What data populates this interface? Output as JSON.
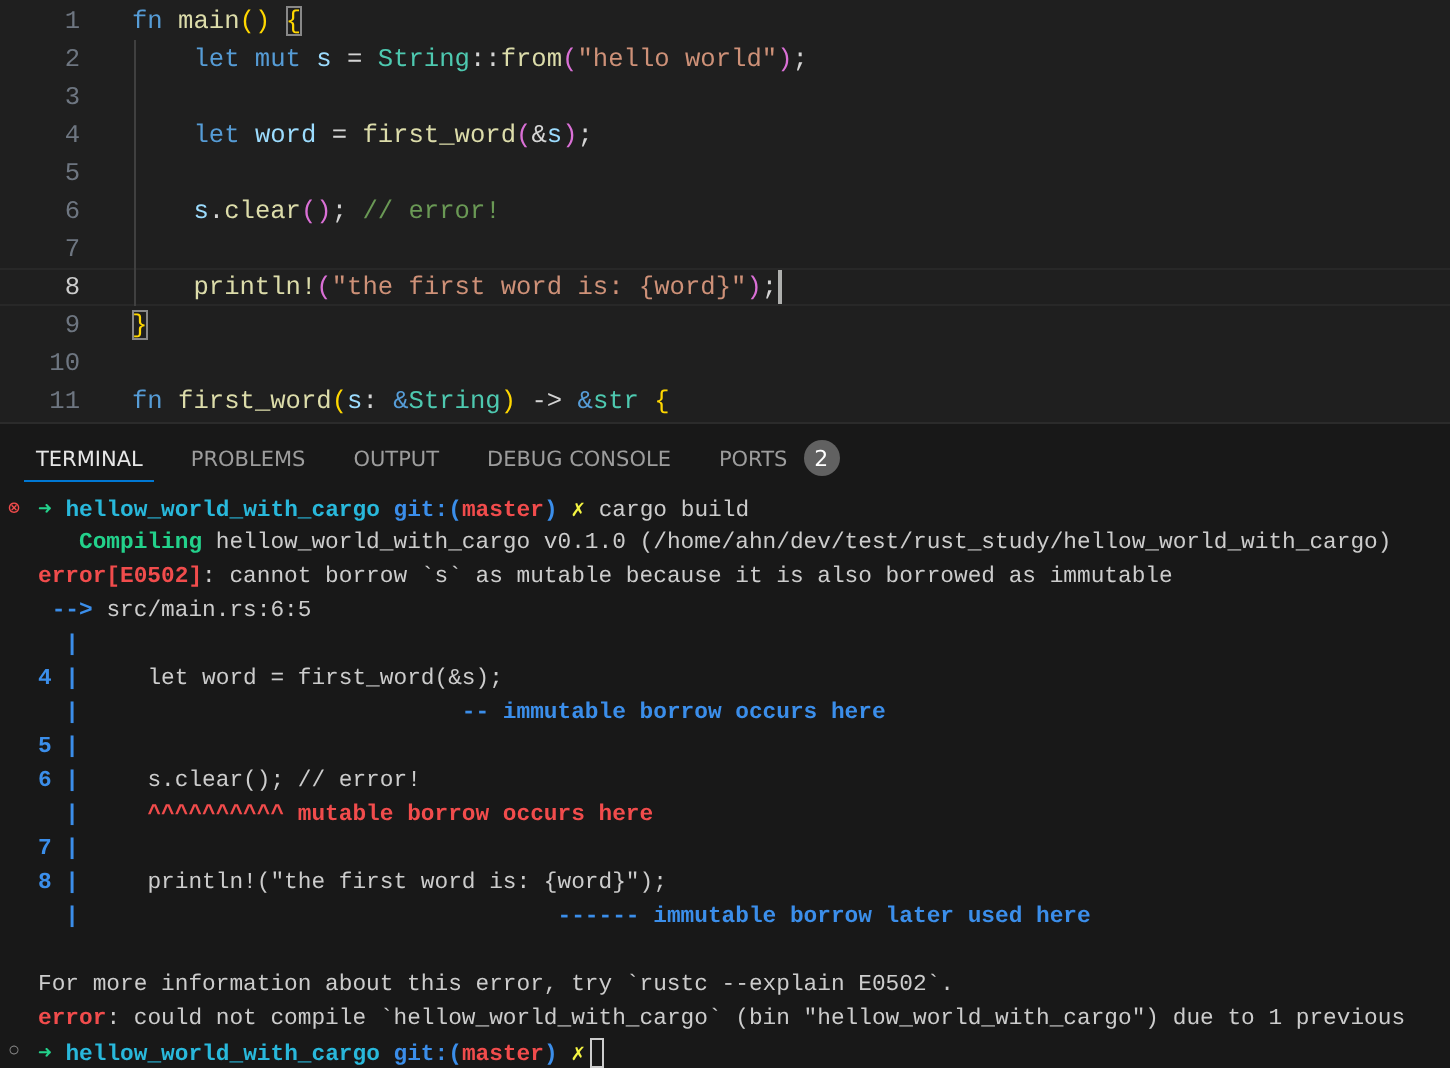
{
  "editor": {
    "lines": [
      {
        "number": "1",
        "current": false,
        "tokens": [
          {
            "text": "fn ",
            "kind": "keyword"
          },
          {
            "text": "main",
            "kind": "function"
          },
          {
            "text": "() ",
            "kind": "bracket1"
          },
          {
            "text": "{",
            "kind": "bracket-match"
          }
        ]
      },
      {
        "number": "2",
        "current": false,
        "tokens": [
          {
            "text": "    let mut ",
            "kind": "keyword"
          },
          {
            "text": "s",
            "kind": "variable"
          },
          {
            "text": " = ",
            "kind": "plain"
          },
          {
            "text": "String",
            "kind": "type"
          },
          {
            "text": "::",
            "kind": "plain"
          },
          {
            "text": "from",
            "kind": "function"
          },
          {
            "text": "(",
            "kind": "bracket2"
          },
          {
            "text": "\"hello world\"",
            "kind": "string"
          },
          {
            "text": ")",
            "kind": "bracket2"
          },
          {
            "text": ";",
            "kind": "plain"
          }
        ]
      },
      {
        "number": "3",
        "current": false
      },
      {
        "number": "4",
        "current": false,
        "tokens": [
          {
            "text": "    let ",
            "kind": "keyword"
          },
          {
            "text": "word",
            "kind": "variable"
          },
          {
            "text": " = ",
            "kind": "plain"
          },
          {
            "text": "first_word",
            "kind": "function"
          },
          {
            "text": "(",
            "kind": "bracket2"
          },
          {
            "text": "&",
            "kind": "plain"
          },
          {
            "text": "s",
            "kind": "variable"
          },
          {
            "text": ")",
            "kind": "bracket2"
          },
          {
            "text": ";",
            "kind": "plain"
          }
        ]
      },
      {
        "number": "5",
        "current": false
      },
      {
        "number": "6",
        "current": false,
        "tokens": [
          {
            "text": "    s",
            "kind": "variable"
          },
          {
            "text": ".",
            "kind": "plain"
          },
          {
            "text": "clear",
            "kind": "function"
          },
          {
            "text": "()",
            "kind": "bracket2"
          },
          {
            "text": "; ",
            "kind": "plain"
          },
          {
            "text": "// error!",
            "kind": "comment"
          }
        ]
      },
      {
        "number": "7",
        "current": false
      },
      {
        "number": "8",
        "current": true,
        "cursor": true,
        "tokens": [
          {
            "text": "    println!",
            "kind": "function"
          },
          {
            "text": "(",
            "kind": "bracket2"
          },
          {
            "text": "\"the first word is: {word}\"",
            "kind": "string"
          },
          {
            "text": ")",
            "kind": "bracket2"
          },
          {
            "text": ";",
            "kind": "plain"
          }
        ]
      },
      {
        "number": "9",
        "current": false,
        "tokens": [
          {
            "text": "}",
            "kind": "bracket-match"
          }
        ]
      },
      {
        "number": "10",
        "current": false
      },
      {
        "number": "11",
        "current": false,
        "tokens": [
          {
            "text": "fn ",
            "kind": "keyword"
          },
          {
            "text": "first_word",
            "kind": "function"
          },
          {
            "text": "(",
            "kind": "bracket1"
          },
          {
            "text": "s",
            "kind": "variable"
          },
          {
            "text": ": ",
            "kind": "plain"
          },
          {
            "text": "&",
            "kind": "keyword"
          },
          {
            "text": "String",
            "kind": "type"
          },
          {
            "text": ")",
            "kind": "bracket1"
          },
          {
            "text": " -> ",
            "kind": "plain"
          },
          {
            "text": "&",
            "kind": "keyword"
          },
          {
            "text": "str ",
            "kind": "type"
          },
          {
            "text": "{",
            "kind": "bracket1"
          }
        ]
      }
    ]
  },
  "panel": {
    "tabs": [
      {
        "label": "TERMINAL",
        "selected": true
      },
      {
        "label": "PROBLEMS",
        "selected": false
      },
      {
        "label": "OUTPUT",
        "selected": false
      },
      {
        "label": "DEBUG CONSOLE",
        "selected": false
      },
      {
        "label": "PORTS",
        "selected": false,
        "badge": "2"
      }
    ],
    "terminal": {
      "lines": [
        {
          "kind": "prompt",
          "status": "⊗",
          "segments": [
            {
              "text": "➜ ",
              "kind": "arrow"
            },
            {
              "text": "hellow_world_with_cargo ",
              "kind": "dir"
            },
            {
              "text": "git:(",
              "kind": "git"
            },
            {
              "text": "master",
              "kind": "branch"
            },
            {
              "text": ") ",
              "kind": "git"
            },
            {
              "text": "✗ ",
              "kind": "dirty"
            },
            {
              "text": "cargo build",
              "kind": "plain"
            }
          ]
        },
        {
          "kind": "output",
          "segments": [
            {
              "text": "   Compiling",
              "kind": "success"
            },
            {
              "text": " hellow_world_with_cargo v0.1.0 (/home/ahn/dev/test/rust_study/hellow_world_with_cargo)",
              "kind": "plain"
            }
          ]
        },
        {
          "kind": "output",
          "segments": [
            {
              "text": "error[E0502]",
              "kind": "error"
            },
            {
              "text": ": cannot borrow `s` as mutable because it is also borrowed as immutable",
              "kind": "plain"
            }
          ]
        },
        {
          "kind": "output",
          "segments": [
            {
              "text": " --> ",
              "kind": "gutter"
            },
            {
              "text": "src/main.rs:6:5",
              "kind": "plain"
            }
          ]
        },
        {
          "kind": "output",
          "segments": [
            {
              "text": "  |",
              "kind": "gutter"
            }
          ]
        },
        {
          "kind": "output",
          "segments": [
            {
              "text": "4 |",
              "kind": "gutter"
            },
            {
              "text": "     let word = first_word(&s);",
              "kind": "plain"
            }
          ]
        },
        {
          "kind": "output",
          "segments": [
            {
              "text": "  |",
              "kind": "gutter"
            },
            {
              "text": "                            -- immutable borrow occurs here",
              "kind": "note"
            }
          ]
        },
        {
          "kind": "output",
          "segments": [
            {
              "text": "5 |",
              "kind": "gutter"
            }
          ]
        },
        {
          "kind": "output",
          "segments": [
            {
              "text": "6 |",
              "kind": "gutter"
            },
            {
              "text": "     s.clear(); // error!",
              "kind": "plain"
            }
          ]
        },
        {
          "kind": "output",
          "segments": [
            {
              "text": "  |",
              "kind": "gutter"
            },
            {
              "text": "     ^^^^^^^^^^ mutable borrow occurs here",
              "kind": "label"
            }
          ]
        },
        {
          "kind": "output",
          "segments": [
            {
              "text": "7 |",
              "kind": "gutter"
            }
          ]
        },
        {
          "kind": "output",
          "segments": [
            {
              "text": "8 |",
              "kind": "gutter"
            },
            {
              "text": "     println!(\"the first word is: {word}\");",
              "kind": "plain"
            }
          ]
        },
        {
          "kind": "output",
          "segments": [
            {
              "text": "  |",
              "kind": "gutter"
            },
            {
              "text": "                                   ------ immutable borrow later used here",
              "kind": "note"
            }
          ]
        },
        {
          "kind": "output",
          "gap_before": true,
          "segments": [
            {
              "text": "For more information about this error, try `rustc --explain E0502`.",
              "kind": "plain"
            }
          ]
        },
        {
          "kind": "output",
          "segments": [
            {
              "text": "error",
              "kind": "error"
            },
            {
              "text": ": could not compile `hellow_world_with_cargo` (bin \"hellow_world_with_cargo\") due to 1 previous",
              "kind": "plain"
            }
          ]
        },
        {
          "kind": "prompt",
          "status": "○",
          "cursor": true,
          "segments": [
            {
              "text": "➜ ",
              "kind": "arrow"
            },
            {
              "text": "hellow_world_with_cargo ",
              "kind": "dir"
            },
            {
              "text": "git:(",
              "kind": "git"
            },
            {
              "text": "master",
              "kind": "branch"
            },
            {
              "text": ") ",
              "kind": "git"
            },
            {
              "text": "✗",
              "kind": "dirty"
            }
          ]
        }
      ]
    }
  }
}
